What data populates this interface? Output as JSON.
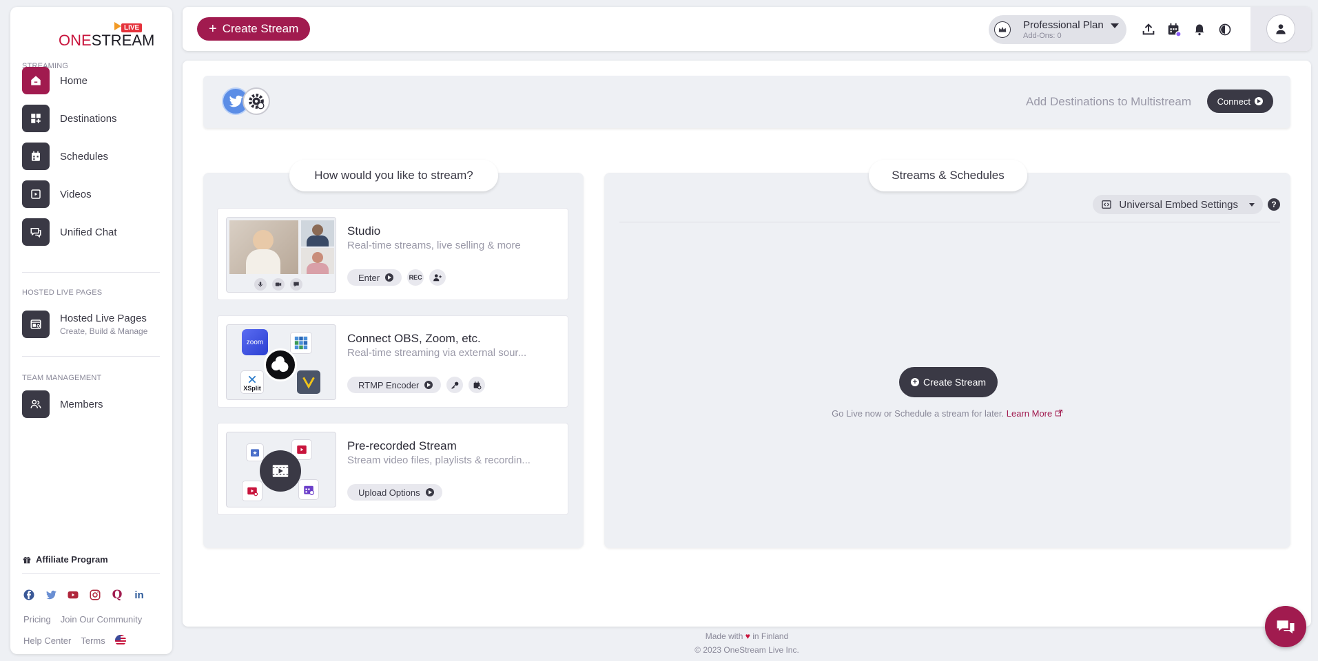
{
  "brand": {
    "one": "ONE",
    "stream": "STREAM",
    "badge": "LIVE"
  },
  "sidebar": {
    "sections": {
      "streaming": "STREAMING",
      "hosted": "HOSTED LIVE PAGES",
      "team": "TEAM MANAGEMENT"
    },
    "items": [
      {
        "label": "Home",
        "icon": "home-icon"
      },
      {
        "label": "Destinations",
        "icon": "destinations-icon"
      },
      {
        "label": "Schedules",
        "icon": "calendar-icon"
      },
      {
        "label": "Videos",
        "icon": "videos-icon"
      },
      {
        "label": "Unified Chat",
        "icon": "chat-icon"
      }
    ],
    "hosted": {
      "label": "Hosted Live Pages",
      "sub": "Create, Build & Manage"
    },
    "members": {
      "label": "Members"
    },
    "affiliate": "Affiliate Program",
    "links": {
      "pricing": "Pricing",
      "community": "Join Our Community",
      "help": "Help Center",
      "terms": "Terms"
    }
  },
  "topbar": {
    "create_label": "Create Stream",
    "plan_name": "Professional Plan",
    "plan_addons": "Add-Ons: 0"
  },
  "destinations": {
    "text": "Add Destinations to Multistream",
    "connect_label": "Connect"
  },
  "left_panel": {
    "title": "How would you like to stream?",
    "cards": [
      {
        "title": "Studio",
        "desc": "Real-time streams, live selling & more",
        "action": "Enter",
        "rec": "REC"
      },
      {
        "title": "Connect OBS, Zoom, etc.",
        "desc": "Real-time streaming via external sour...",
        "action": "RTMP Encoder",
        "zoom": "zoom",
        "xsplit": "XSplit"
      },
      {
        "title": "Pre-recorded Stream",
        "desc": "Stream video files, playlists & recordin...",
        "action": "Upload Options"
      }
    ]
  },
  "right_panel": {
    "title": "Streams & Schedules",
    "embed_label": "Universal Embed Settings",
    "help": "?",
    "create_label": "Create Stream",
    "golive_text": "Go Live now or Schedule a stream for later.",
    "learn_more": "Learn More"
  },
  "footer": {
    "made_prefix": "Made with",
    "made_suffix": "in Finland",
    "copyright": "© 2023 OneStream Live Inc."
  },
  "colors": {
    "accent": "#a11b4f",
    "dark": "#3a3945",
    "bg": "#eef0f4"
  }
}
